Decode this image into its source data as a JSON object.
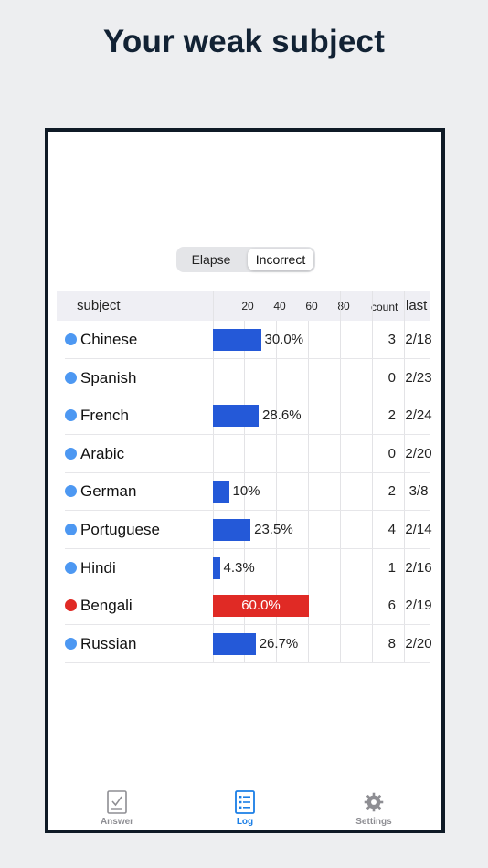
{
  "headline": "Your weak subject",
  "segmented": {
    "options": [
      "Elapse",
      "Incorrect"
    ],
    "selected": "Incorrect"
  },
  "table": {
    "header": {
      "subject": "subject",
      "ticks": [
        "20",
        "40",
        "60",
        "80"
      ],
      "count": "count",
      "last": "last"
    },
    "axis_max": 100,
    "rows": [
      {
        "subject": "Chinese",
        "percent": 30.0,
        "label": "30.0%",
        "count": "3",
        "last": "2/18",
        "status": "normal"
      },
      {
        "subject": "Spanish",
        "percent": 0,
        "label": "",
        "count": "0",
        "last": "2/23",
        "status": "normal"
      },
      {
        "subject": "French",
        "percent": 28.6,
        "label": "28.6%",
        "count": "2",
        "last": "2/24",
        "status": "normal"
      },
      {
        "subject": "Arabic",
        "percent": 0,
        "label": "",
        "count": "0",
        "last": "2/20",
        "status": "normal"
      },
      {
        "subject": "German",
        "percent": 10,
        "label": "10%",
        "count": "2",
        "last": "3/8",
        "status": "normal"
      },
      {
        "subject": "Portuguese",
        "percent": 23.5,
        "label": "23.5%",
        "count": "4",
        "last": "2/14",
        "status": "normal"
      },
      {
        "subject": "Hindi",
        "percent": 4.3,
        "label": "4.3%",
        "count": "1",
        "last": "2/16",
        "status": "normal"
      },
      {
        "subject": "Bengali",
        "percent": 60.0,
        "label": "60.0%",
        "count": "6",
        "last": "2/19",
        "status": "weak"
      },
      {
        "subject": "Russian",
        "percent": 26.7,
        "label": "26.7%",
        "count": "8",
        "last": "2/20",
        "status": "normal"
      }
    ]
  },
  "colors": {
    "normal_dot": "#4d98f2",
    "normal_bar": "#2459d8",
    "weak": "#e02a25",
    "tab_active": "#1a7ee6",
    "tab_inactive": "#8e8e93"
  },
  "tabs": [
    {
      "label": "Answer",
      "icon": "answer-sheet-icon",
      "active": false
    },
    {
      "label": "Log",
      "icon": "log-list-icon",
      "active": true
    },
    {
      "label": "Settings",
      "icon": "gear-icon",
      "active": false
    }
  ]
}
